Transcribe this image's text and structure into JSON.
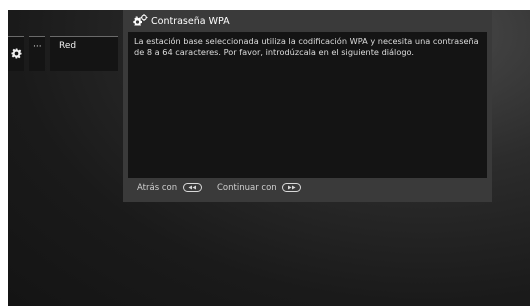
{
  "sidebar": {
    "gear_icon": "gear-icon",
    "dots_label": "···",
    "network_label": "Red"
  },
  "dialog": {
    "icon": "gears-icon",
    "title": "Contraseña WPA",
    "message": "La estación base seleccionada utiliza la codificación WPA y necesita una contraseña de 8 a 64 caracteres. Por favor, introdúzcala en el siguiente diálogo."
  },
  "footer": {
    "back_label": "Atrás con",
    "back_icon": "rewind-key-icon",
    "next_label": "Continuar con",
    "next_icon": "forward-key-icon"
  },
  "colors": {
    "background": "#1a1a1a",
    "dialog_frame": "#3a3a3a",
    "dialog_body": "#141414",
    "text": "#ffffff"
  }
}
